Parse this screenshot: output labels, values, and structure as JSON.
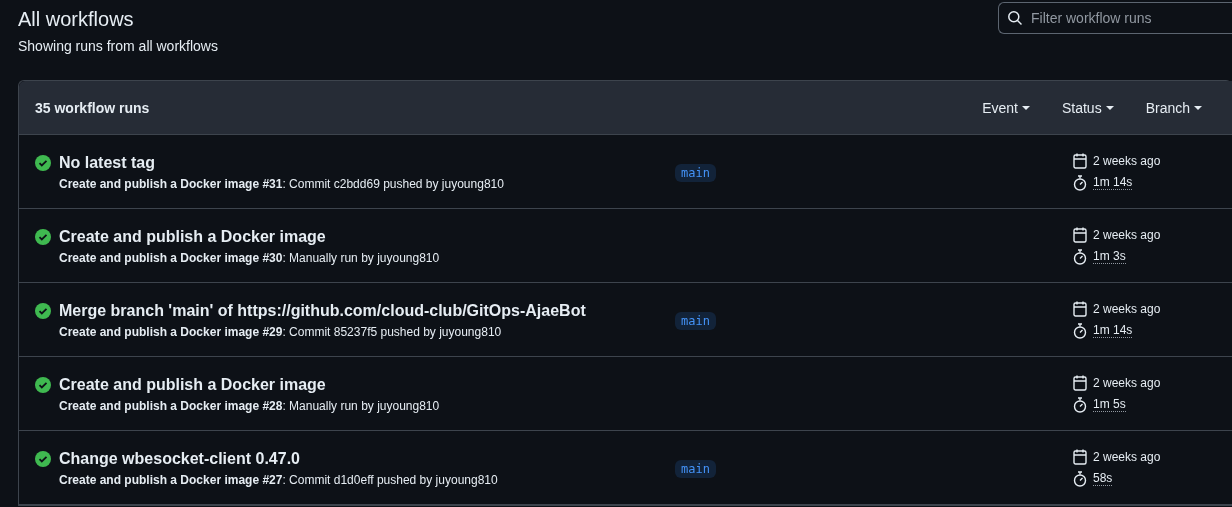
{
  "page": {
    "title": "All workflows",
    "subtitle": "Showing runs from all workflows"
  },
  "search": {
    "placeholder": "Filter workflow runs"
  },
  "runs_header": {
    "count": "35 workflow runs",
    "filters": [
      "Event",
      "Status",
      "Branch"
    ]
  },
  "runs": [
    {
      "kind": "success",
      "title": "No latest tag",
      "detail": "**Create and publish a Docker image #31**: Commit c2bdd69 pushed by juyoung810",
      "branch": "main",
      "date": "2 weeks ago",
      "duration": "1m 14s"
    },
    {
      "kind": "success",
      "title": "Create and publish a Docker image",
      "detail": "**Create and publish a Docker image #30**: Manually run by juyoung810",
      "date": "2 weeks ago",
      "duration": "1m 3s"
    },
    {
      "kind": "success",
      "title": "Merge branch 'main' of https://github.com/cloud-club/GitOps-AjaeBot",
      "detail": "**Create and publish a Docker image #29**: Commit 85237f5 pushed by juyoung810",
      "branch": "main",
      "date": "2 weeks ago",
      "duration": "1m 14s"
    },
    {
      "kind": "success",
      "title": "Create and publish a Docker image",
      "detail": "**Create and publish a Docker image #28**: Manually run by juyoung810",
      "date": "2 weeks ago",
      "duration": "1m 5s"
    },
    {
      "kind": "success",
      "title": "Change wbesocket-client 0.47.0",
      "detail": "**Create and publish a Docker image #27**: Commit d1d0eff pushed by juyoung810",
      "branch": "main",
      "date": "2 weeks ago",
      "duration": "58s"
    }
  ]
}
